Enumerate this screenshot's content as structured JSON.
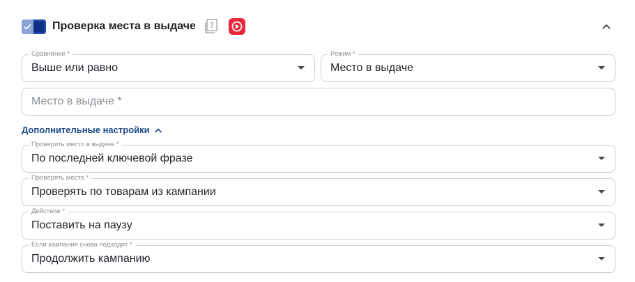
{
  "header": {
    "title": "Проверка места в выдаче",
    "toggle_on": true,
    "help_icon": "help-square-icon",
    "video_icon": "video-play-icon",
    "video_color": "#e8273a",
    "collapse_icon": "chevron-up-icon"
  },
  "colors": {
    "toggle": "#1e45a8",
    "link": "#1e4a8a",
    "border": "#c9ccd1",
    "label": "#8a8f96"
  },
  "comparison": {
    "label": "Сравнение *",
    "value": "Выше или равно"
  },
  "mode": {
    "label": "Режим *",
    "value": "Место в выдаче"
  },
  "position": {
    "placeholder": "Место в выдаче *",
    "value": ""
  },
  "advanced": {
    "label": "Дополнительные настройки",
    "expanded": true
  },
  "check_place": {
    "label": "Проверить место в выдаче *",
    "value": "По последней ключевой фразе"
  },
  "check_by": {
    "label": "Проверять место *",
    "value": "Проверять по товарам из кампании"
  },
  "action": {
    "label": "Действие *",
    "value": "Поставить на паузу"
  },
  "if_fits_again": {
    "label": "Если кампания снова подходит *",
    "value": "Продолжить кампанию"
  }
}
